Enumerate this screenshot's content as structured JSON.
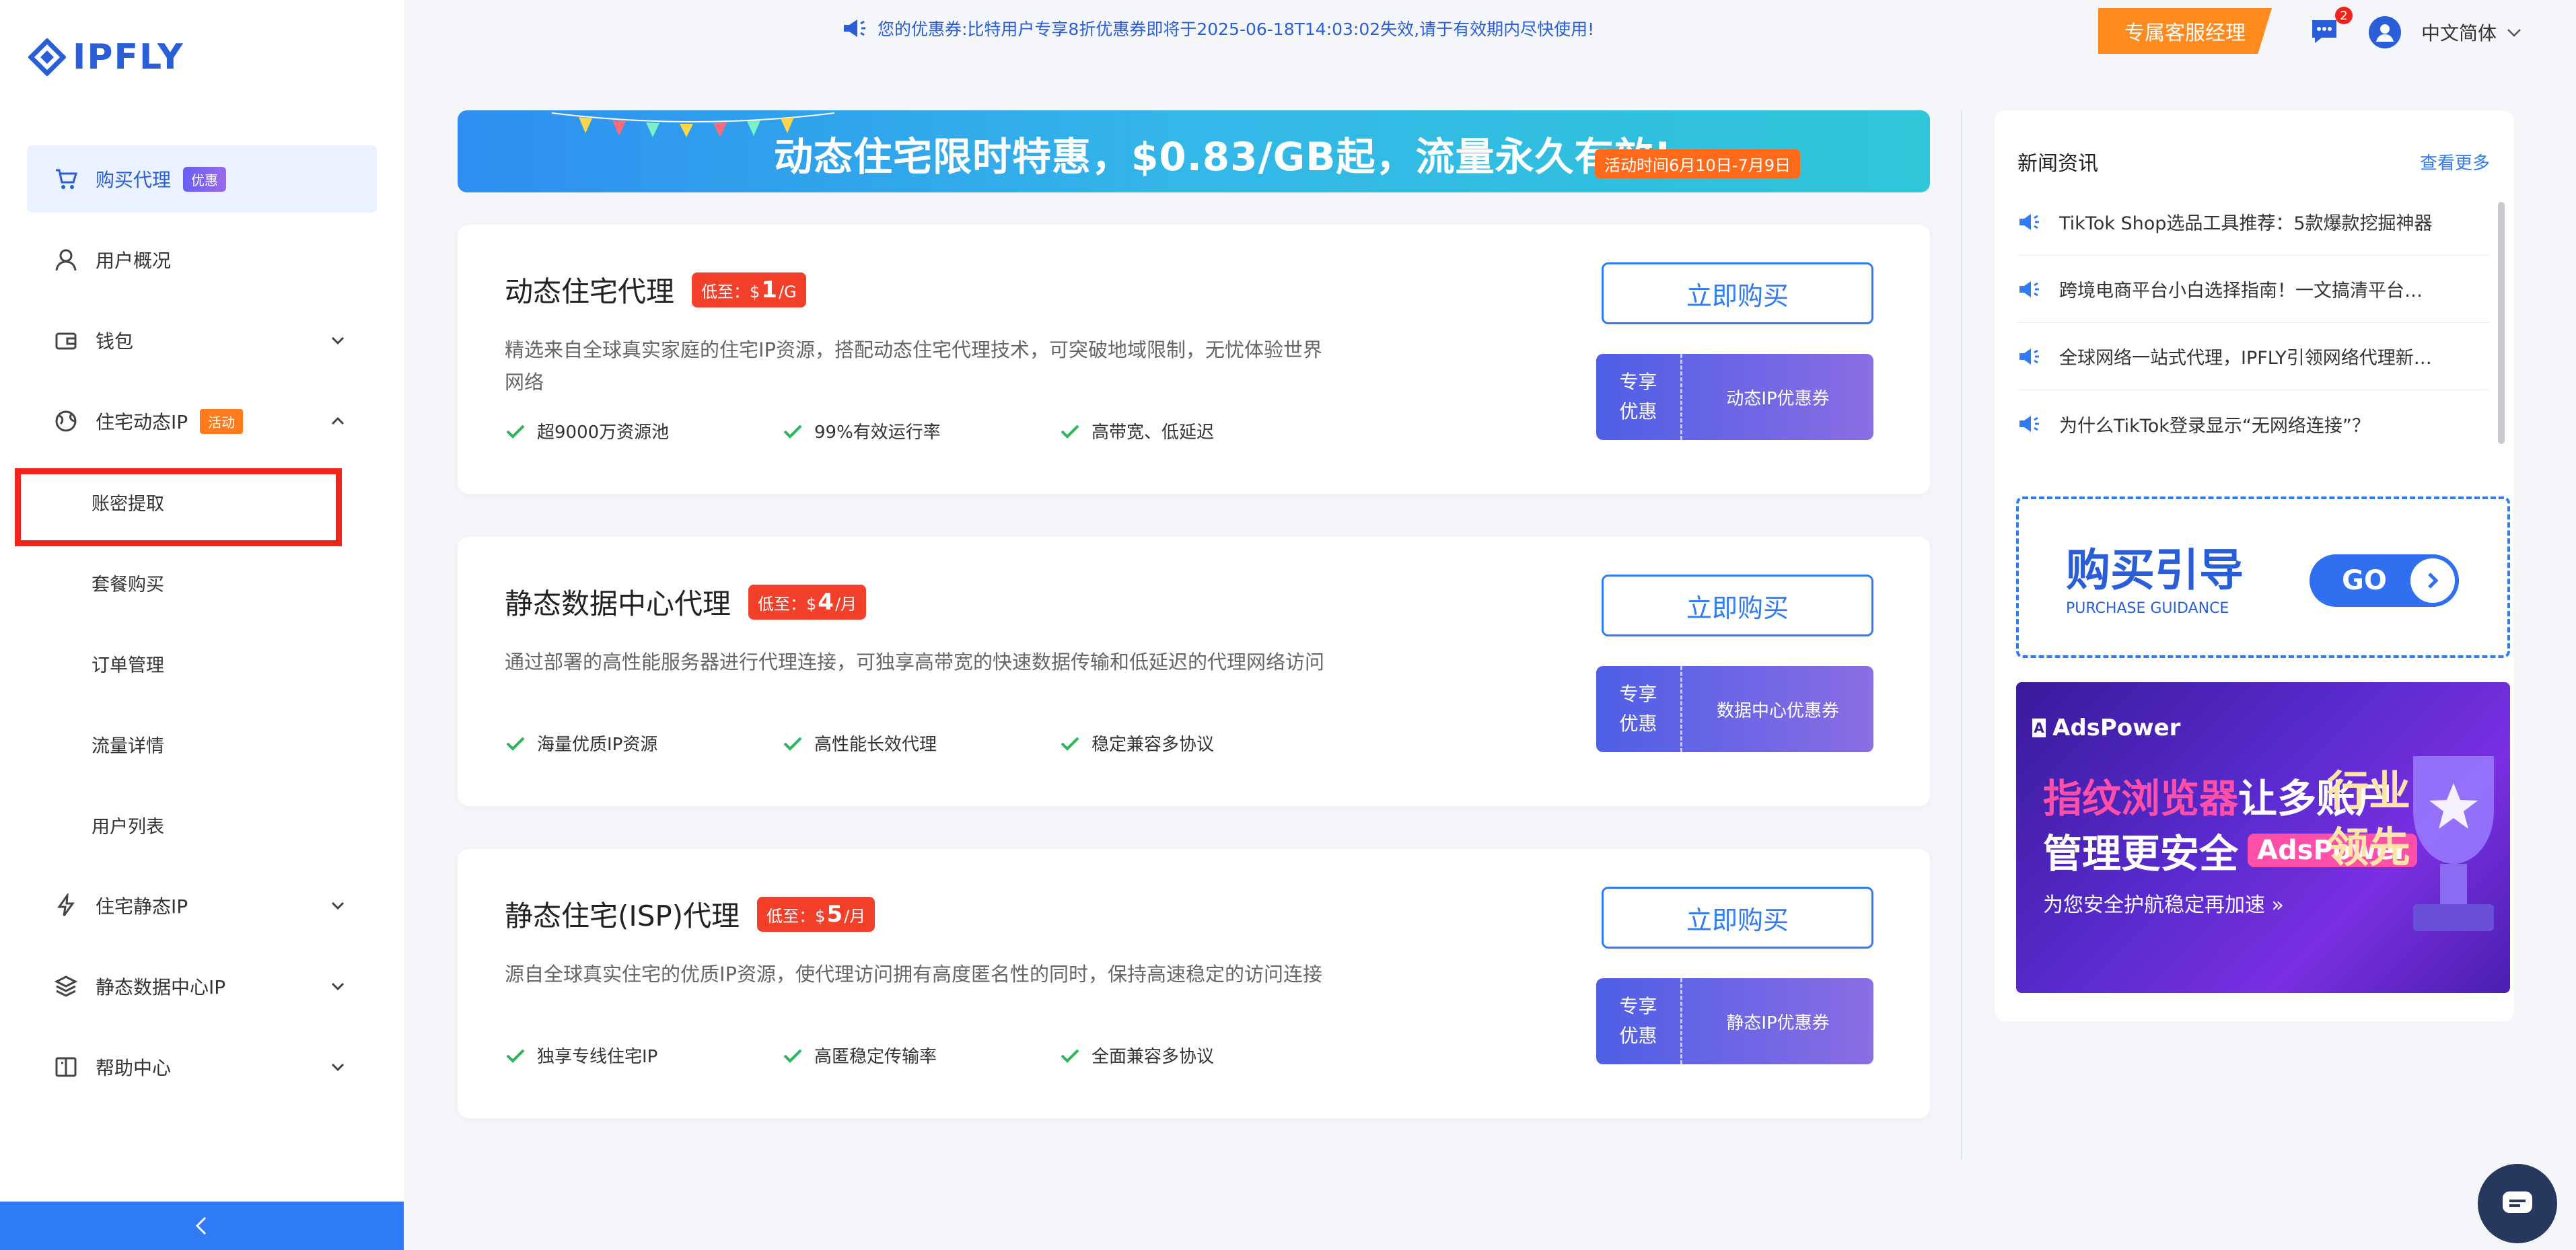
{
  "brand": {
    "name": "IPFLY",
    "color": "#2a5ed8"
  },
  "sidebar": {
    "items": [
      {
        "label": "购买代理",
        "icon": "cart-icon",
        "badge": "优惠",
        "active": true
      },
      {
        "label": "用户概况",
        "icon": "user-icon"
      },
      {
        "label": "钱包",
        "icon": "wallet-icon",
        "chevron": "chevron-down-icon"
      },
      {
        "label": "住宅动态IP",
        "icon": "globe-icon",
        "badge": "活动",
        "chevron": "chevron-up-icon"
      },
      {
        "label": "住宅静态IP",
        "icon": "lightning-icon",
        "chevron": "chevron-down-icon"
      },
      {
        "label": "静态数据中心IP",
        "icon": "server-icon",
        "chevron": "chevron-down-icon"
      },
      {
        "label": "帮助中心",
        "icon": "book-icon",
        "chevron": "chevron-down-icon"
      }
    ],
    "subitems": [
      "账密提取",
      "套餐购买",
      "订单管理",
      "流量详情",
      "用户列表"
    ],
    "collapse_icon": "chevron-left-icon"
  },
  "topbar": {
    "notice": "您的优惠券:比特用户专享8折优惠券即将于2025-06-18T14:03:02失效,请于有效期内尽快使用!",
    "exclusive_label": "专属客服经理",
    "message_count": "2",
    "language": "中文简体"
  },
  "banner": {
    "text": "动态住宅限时特惠，$0.83/GB起，流量永久有效!",
    "date": "活动时间6月10日-7月9日"
  },
  "products": [
    {
      "title": "动态住宅代理",
      "price_prefix": "低至：$",
      "price_num": "1",
      "price_unit": "/G",
      "desc": "精选来自全球真实家庭的住宅IP资源，搭配动态住宅代理技术，可突破地域限制，无忧体验世界网络",
      "features": [
        "超9000万资源池",
        "99%有效运行率",
        "高带宽、低延迟"
      ],
      "buy_label": "立即购买",
      "coupon_left": [
        "专享",
        "优惠"
      ],
      "coupon_right": "动态IP优惠券"
    },
    {
      "title": "静态数据中心代理",
      "price_prefix": "低至：$",
      "price_num": "4",
      "price_unit": "/月",
      "desc": "通过部署的高性能服务器进行代理连接，可独享高带宽的快速数据传输和低延迟的代理网络访问",
      "features": [
        "海量优质IP资源",
        "高性能长效代理",
        "稳定兼容多协议"
      ],
      "buy_label": "立即购买",
      "coupon_left": [
        "专享",
        "优惠"
      ],
      "coupon_right": "数据中心优惠券"
    },
    {
      "title": "静态住宅(ISP)代理",
      "price_prefix": "低至：$",
      "price_num": "5",
      "price_unit": "/月",
      "desc": "源自全球真实住宅的优质IP资源，使代理访问拥有高度匿名性的同时，保持高速稳定的访问连接",
      "features": [
        "独享专线住宅IP",
        "高匿稳定传输率",
        "全面兼容多协议"
      ],
      "buy_label": "立即购买",
      "coupon_left": [
        "专享",
        "优惠"
      ],
      "coupon_right": "静态IP优惠券"
    }
  ],
  "news": {
    "title": "新闻资讯",
    "more": "查看更多",
    "items": [
      "TikTok Shop选品工具推荐：5款爆款挖掘神器",
      "跨境电商平台小白选择指南！一文搞清平台…",
      "全球网络一站式代理，IPFLY引领网络代理新…",
      "为什么TikTok登录显示“无网络连接”？"
    ]
  },
  "guide": {
    "title": "购买引导",
    "subtitle": "PURCHASE GUIDANCE",
    "go": "GO"
  },
  "ad": {
    "brand": "AdsPower",
    "line1_highlight": "指纹浏览器",
    "line1_rest": "让多账户",
    "line2": "管理更安全",
    "line2_pill": "AdsPower",
    "line3": "为您安全护航稳定再加速 »",
    "lead": [
      "行业",
      "领先"
    ]
  },
  "colors": {
    "accent": "#2f7cf6",
    "orange": "#ff8a1d",
    "red": "#f2231b"
  }
}
